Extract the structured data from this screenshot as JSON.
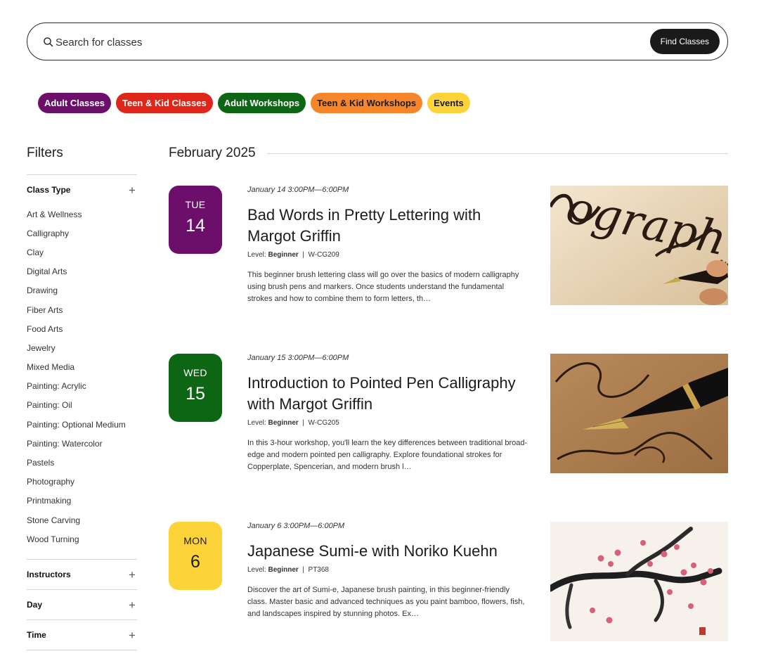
{
  "search": {
    "placeholder": "Search for classes",
    "button_label": "Find Classes"
  },
  "categories": [
    {
      "label": "Adult Classes",
      "bg": "#6b0f6b",
      "fg": "#ffffff"
    },
    {
      "label": "Teen & Kid Classes",
      "bg": "#e0251a",
      "fg": "#ffffff"
    },
    {
      "label": "Adult Workshops",
      "bg": "#0d6614",
      "fg": "#ffffff"
    },
    {
      "label": "Teen & Kid Workshops",
      "bg": "#f7852a",
      "fg": "#1c1c1c"
    },
    {
      "label": "Events",
      "bg": "#fdd33a",
      "fg": "#1c1c1c"
    }
  ],
  "filters": {
    "title": "Filters",
    "class_type": {
      "label": "Class Type",
      "options": [
        "Art & Wellness",
        "Calligraphy",
        "Clay",
        "Digital Arts",
        "Drawing",
        "Fiber Arts",
        "Food Arts",
        "Jewelry",
        "Mixed Media",
        "Painting: Acrylic",
        "Painting: Oil",
        "Painting: Optional Medium",
        "Painting: Watercolor",
        "Pastels",
        "Photography",
        "Printmaking",
        "Stone Carving",
        "Wood Turning"
      ]
    },
    "collapsed": [
      {
        "label": "Instructors"
      },
      {
        "label": "Day"
      },
      {
        "label": "Time"
      }
    ],
    "expand_symbol": "+"
  },
  "month": "February 2025",
  "level_prefix": "Level:",
  "events": [
    {
      "day": "TUE",
      "date": "14",
      "tile_color": "#6b0f6b",
      "tile_text_color": "#ffffff",
      "when": "January 14 3:00PM—6:00PM",
      "title": "Bad Words in Pretty Lettering with Margot Griffin",
      "level": "Beginner",
      "code": "W-CG209",
      "description": "This beginner brush lettering class will go over the basics of modern calligraphy using brush pens and markers. Once students understand the fundamental strokes and how to combine them to form letters, th…",
      "image": "calligraphy-word-photo"
    },
    {
      "day": "WED",
      "date": "15",
      "tile_color": "#0d6614",
      "tile_text_color": "#ffffff",
      "when": "January 15 3:00PM—6:00PM",
      "title": "Introduction to Pointed Pen Calligraphy with Margot Griffin",
      "level": "Beginner",
      "code": "W-CG205",
      "description": "In this 3-hour workshop, you'll learn the key differences between traditional broad-edge and modern pointed pen calligraphy. Explore foundational strokes for Copperplate, Spencerian, and modern brush l…",
      "image": "fountain-pen-photo"
    },
    {
      "day": "MON",
      "date": "6",
      "tile_color": "#fdd33a",
      "tile_text_color": "#1c1c1c",
      "when": "January 6 3:00PM—6:00PM",
      "title": "Japanese Sumi-e with Noriko Kuehn",
      "level": "Beginner",
      "code": "PT368",
      "description": "Discover the art of Sumi-e, Japanese brush painting, in this beginner-friendly class. Master basic and advanced techniques as you paint bamboo, flowers, fish, and landscapes inspired by stunning photos. Ex…",
      "image": "sumi-e-blossom-painting"
    }
  ]
}
